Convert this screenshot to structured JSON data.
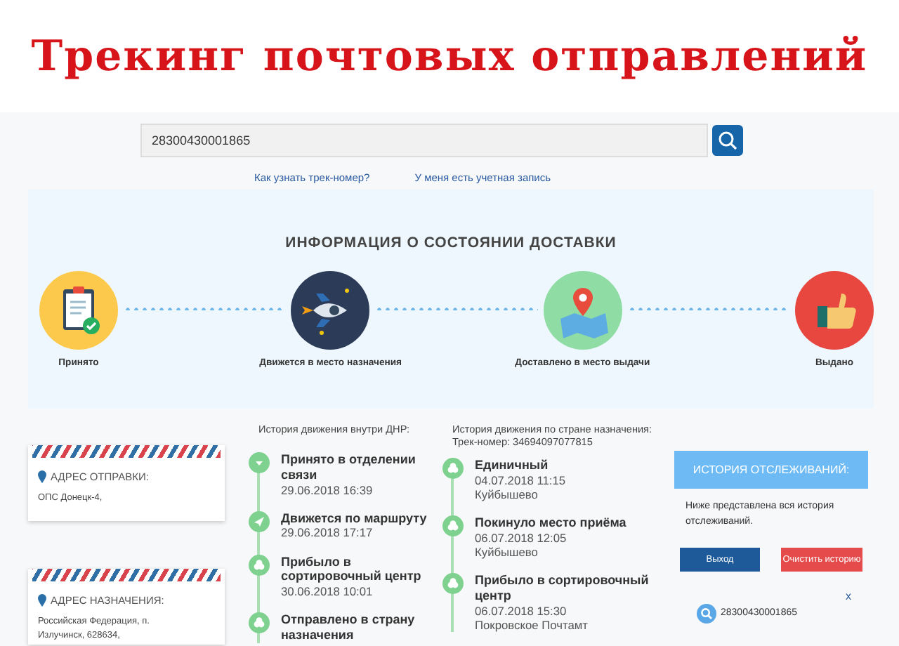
{
  "banner": {
    "title": "Трекинг почтовых отправлений"
  },
  "search": {
    "value": "28300430001865"
  },
  "links": [
    "Как узнать трек-номер?",
    "У меня есть учетная запись"
  ],
  "status": {
    "title": "ИНФОРМАЦИЯ О СОСТОЯНИИ ДОСТАВКИ",
    "steps": [
      {
        "kind": "accepted",
        "label": "Принято"
      },
      {
        "kind": "moving",
        "label": "Движется в место назначения"
      },
      {
        "kind": "delivered",
        "label": "Доставлено в место выдачи"
      },
      {
        "kind": "issued",
        "label": "Выдано"
      }
    ]
  },
  "addresses": [
    {
      "title": "АДРЕС ОТПРАВКИ:",
      "text": "ОПС Донецк-4,"
    },
    {
      "title": "АДРЕС НАЗНАЧЕНИЯ:",
      "text": "Российская Федерация, п. Излучинск, 628634,"
    }
  ],
  "history_dnr": {
    "heading": "История движения внутри ДНР:",
    "events": [
      {
        "kind": "accepted",
        "title": "Принято в отделении связи",
        "date": "29.06.2018 16:39"
      },
      {
        "kind": "route",
        "title": "Движется по маршруту",
        "date": "29.06.2018 17:17"
      },
      {
        "kind": "sort",
        "title": "Прибыло в сортировочный центр",
        "date": "30.06.2018 10:01"
      },
      {
        "kind": "sort",
        "title": "Отправлено в страну назначения"
      }
    ]
  },
  "history_dest": {
    "heading": "История движения по стране назначения:",
    "track": "Трек-номер: 34694097077815",
    "events": [
      {
        "kind": "sort",
        "title": "Единичный",
        "date": "04.07.2018 11:15",
        "place": "Куйбышево"
      },
      {
        "kind": "sort",
        "title": "Покинуло место приёма",
        "date": "06.07.2018 12:05",
        "place": "Куйбышево"
      },
      {
        "kind": "sort",
        "title": "Прибыло в сортировочный центр",
        "date": "06.07.2018 15:30",
        "place": "Покровское Почтамт"
      }
    ]
  },
  "tracking_history": {
    "header": "ИСТОРИЯ ОТСЛЕЖИВАНИЙ:",
    "description": "Ниже представлена вся история отслеживаний.",
    "buttons": [
      {
        "kind": "logout",
        "label": "Выход"
      },
      {
        "kind": "clear",
        "label": "Очистить историю"
      }
    ],
    "close": "x",
    "items": [
      "28300430001865"
    ]
  }
}
